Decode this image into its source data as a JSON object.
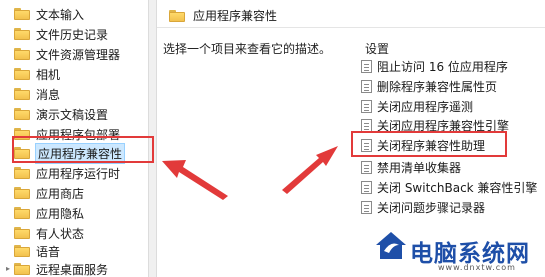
{
  "tree": {
    "items": [
      {
        "label": "文本输入",
        "selected": false
      },
      {
        "label": "文件历史记录",
        "selected": false
      },
      {
        "label": "文件资源管理器",
        "selected": false
      },
      {
        "label": "相机",
        "selected": false
      },
      {
        "label": "消息",
        "selected": false
      },
      {
        "label": "演示文稿设置",
        "selected": false
      },
      {
        "label": "应用程序包部署",
        "selected": false
      },
      {
        "label": "应用程序兼容性",
        "selected": true
      },
      {
        "label": "应用程序运行时",
        "selected": false
      },
      {
        "label": "应用商店",
        "selected": false
      },
      {
        "label": "应用隐私",
        "selected": false
      },
      {
        "label": "有人状态",
        "selected": false
      },
      {
        "label": "语音",
        "selected": false
      },
      {
        "label": "远程桌面服务",
        "selected": false
      }
    ]
  },
  "right": {
    "header_title": "应用程序兼容性",
    "description": "选择一个项目来查看它的描述。",
    "settings_heading": "设置",
    "settings": [
      "阻止访问 16 位应用程序",
      "删除程序兼容性属性页",
      "关闭应用程序遥测",
      "关闭应用程序兼容性引擎",
      "关闭程序兼容性助理",
      "禁用清单收集器",
      "关闭 SwitchBack 兼容性引擎",
      "关闭问题步骤记录器"
    ]
  },
  "annotation": {
    "highlight_color": "#e23a3a"
  },
  "watermark": {
    "title": "电脑系统网",
    "subtitle": "www.dnxtw.com",
    "brand_color": "#1e4fa8"
  }
}
